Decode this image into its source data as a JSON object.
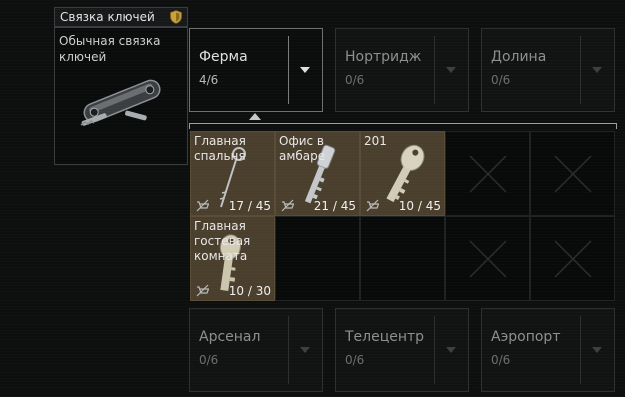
{
  "item": {
    "header": "Связка ключей",
    "name": "Обычная связка ключей"
  },
  "slots_top": [
    {
      "title": "Ферма",
      "count": "4/6",
      "active": true
    },
    {
      "title": "Нортридж",
      "count": "0/6",
      "active": false
    },
    {
      "title": "Долина",
      "count": "0/6",
      "active": false
    }
  ],
  "keys": [
    {
      "label": "Главная спальня",
      "uses": "17 / 45"
    },
    {
      "label": "Офис в амбаре",
      "uses": "21 / 45"
    },
    {
      "label": "201",
      "uses": "10 / 45"
    },
    {
      "label": "Главная гостевая комната",
      "uses": "10 / 30"
    }
  ],
  "slots_bottom": [
    {
      "title": "Арсенал",
      "count": "0/6",
      "active": false
    },
    {
      "title": "Телецентр",
      "count": "0/6",
      "active": false
    },
    {
      "title": "Аэропорт",
      "count": "0/6",
      "active": false
    }
  ],
  "colors": {
    "accent_gold": "#c9a23a",
    "key_cell_bg": "#4a3e2c"
  }
}
